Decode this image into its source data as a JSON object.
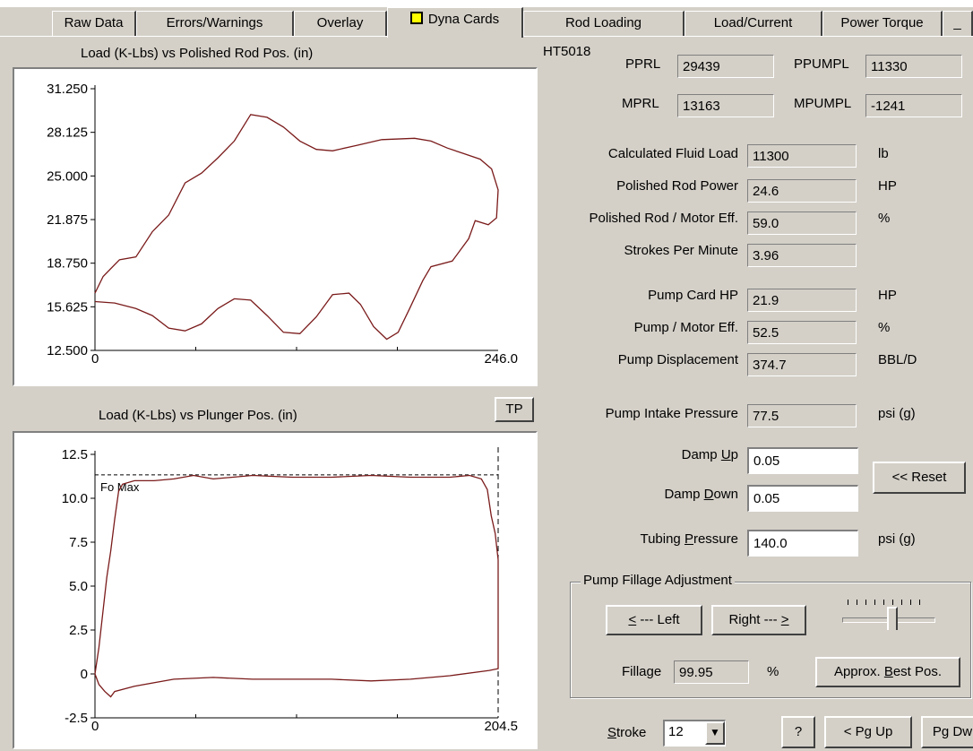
{
  "tabs": [
    {
      "label": "Raw Data"
    },
    {
      "label": "Errors/Warnings"
    },
    {
      "label": "Overlay"
    },
    {
      "label": "Dyna Cards"
    },
    {
      "label": "Rod Loading"
    },
    {
      "label": "Load/Current"
    },
    {
      "label": "Power Torque"
    }
  ],
  "well_id": "HT5018",
  "loads": {
    "pprl_label": "PPRL",
    "pprl": "29439",
    "ppumpl_label": "PPUMPL",
    "ppumpl": "11330",
    "mprl_label": "MPRL",
    "mprl": "13163",
    "mpumpl_label": "MPUMPL",
    "mpumpl": "-1241"
  },
  "metrics": [
    {
      "label": "Calculated Fluid Load",
      "value": "11300",
      "unit": "lb"
    },
    {
      "label": "Polished Rod Power",
      "value": "24.6",
      "unit": "HP"
    },
    {
      "label": "Polished Rod / Motor Eff.",
      "value": "59.0",
      "unit": "%"
    },
    {
      "label": "Strokes Per Minute",
      "value": "3.96",
      "unit": ""
    },
    {
      "label": "Pump Card HP",
      "value": "21.9",
      "unit": "HP"
    },
    {
      "label": "Pump / Motor Eff.",
      "value": "52.5",
      "unit": "%"
    },
    {
      "label": "Pump Displacement",
      "value": "374.7",
      "unit": "BBL/D"
    },
    {
      "label": "Pump Intake Pressure",
      "value": "77.5",
      "unit": "psi (g)"
    }
  ],
  "damping": {
    "up_label_pre": "Damp ",
    "up_label_key": "U",
    "up_label_post": "p",
    "up_value": "0.05",
    "down_label_pre": "Damp ",
    "down_label_key": "D",
    "down_label_post": "own",
    "down_value": "0.05",
    "reset_label": "<< Reset"
  },
  "tubing": {
    "label_pre": "Tubing ",
    "label_key": "P",
    "label_post": "ressure",
    "value": "140.0",
    "unit": "psi (g)"
  },
  "fillage": {
    "group_title": "Pump Fillage Adjustment",
    "left_key": "<",
    "left_rest": " --- Left",
    "right_rest": "Right --- ",
    "right_key": ">",
    "fillage_label": "Fillage",
    "fillage_value": "99.95",
    "fillage_unit": "%",
    "best_pre": "Approx. ",
    "best_key": "B",
    "best_post": "est Pos.",
    "slider_level": 0.55
  },
  "footer": {
    "stroke_key": "S",
    "stroke_rest": "troke",
    "stroke_value": "12",
    "help_label": "?",
    "pgup_label": "< Pg Up",
    "pgdn_label": "Pg Dw"
  },
  "tp_label": "TP",
  "chart_data": [
    {
      "type": "line",
      "title": "Load (K-Lbs) vs Polished Rod Pos. (in)",
      "xlabel": "",
      "ylabel": "",
      "xlim": [
        0,
        246.0
      ],
      "ylim": [
        12.5,
        31.25
      ],
      "x_tick_labels": [
        "0",
        "246.0"
      ],
      "y_tick_labels": [
        "31.250",
        "28.125",
        "25.000",
        "21.875",
        "18.750",
        "15.625",
        "12.500"
      ],
      "series": [
        {
          "values_xy": [
            [
              0,
              16.6
            ],
            [
              5,
              17.8
            ],
            [
              15,
              19.0
            ],
            [
              25,
              19.2
            ],
            [
              35,
              21.0
            ],
            [
              45,
              22.2
            ],
            [
              55,
              24.5
            ],
            [
              65,
              25.2
            ],
            [
              75,
              26.3
            ],
            [
              85,
              27.5
            ],
            [
              95,
              29.4
            ],
            [
              105,
              29.2
            ],
            [
              115,
              28.5
            ],
            [
              125,
              27.5
            ],
            [
              135,
              26.9
            ],
            [
              145,
              26.8
            ],
            [
              160,
              27.2
            ],
            [
              175,
              27.6
            ],
            [
              195,
              27.7
            ],
            [
              205,
              27.5
            ],
            [
              215,
              27.0
            ],
            [
              225,
              26.6
            ],
            [
              235,
              26.2
            ],
            [
              242,
              25.5
            ],
            [
              246,
              24.0
            ],
            [
              245,
              22.0
            ],
            [
              240,
              21.5
            ],
            [
              232,
              21.8
            ],
            [
              228,
              20.5
            ],
            [
              218,
              18.9
            ],
            [
              205,
              18.5
            ],
            [
              200,
              17.5
            ],
            [
              192,
              15.5
            ],
            [
              185,
              13.8
            ],
            [
              178,
              13.3
            ],
            [
              170,
              14.2
            ],
            [
              162,
              15.8
            ],
            [
              155,
              16.6
            ],
            [
              145,
              16.5
            ],
            [
              135,
              14.9
            ],
            [
              125,
              13.7
            ],
            [
              115,
              13.8
            ],
            [
              105,
              15.0
            ],
            [
              95,
              16.1
            ],
            [
              85,
              16.2
            ],
            [
              75,
              15.5
            ],
            [
              65,
              14.4
            ],
            [
              55,
              13.9
            ],
            [
              45,
              14.1
            ],
            [
              35,
              15.0
            ],
            [
              25,
              15.5
            ],
            [
              12,
              15.9
            ],
            [
              0,
              16.0
            ]
          ]
        }
      ],
      "grid": false
    },
    {
      "type": "line",
      "title": "Load (K-Lbs) vs Plunger Pos. (in)",
      "xlabel": "",
      "ylabel": "",
      "xlim": [
        0,
        204.5
      ],
      "ylim": [
        -2.5,
        12.5
      ],
      "x_tick_labels": [
        "0",
        "204.5"
      ],
      "y_tick_labels": [
        "12.5",
        "10.0",
        "7.5",
        "5.0",
        "2.5",
        "0",
        "-2.5"
      ],
      "annotations": [
        "Fo Max"
      ],
      "fo_max": 11.33,
      "series": [
        {
          "values_xy": [
            [
              0,
              0
            ],
            [
              2,
              1.5
            ],
            [
              4,
              3.5
            ],
            [
              6,
              5.5
            ],
            [
              8,
              7.0
            ],
            [
              10,
              8.8
            ],
            [
              12,
              10.4
            ],
            [
              14,
              10.8
            ],
            [
              20,
              11.0
            ],
            [
              30,
              11.0
            ],
            [
              40,
              11.1
            ],
            [
              50,
              11.3
            ],
            [
              60,
              11.1
            ],
            [
              80,
              11.3
            ],
            [
              100,
              11.2
            ],
            [
              120,
              11.2
            ],
            [
              140,
              11.3
            ],
            [
              160,
              11.2
            ],
            [
              180,
              11.2
            ],
            [
              190,
              11.3
            ],
            [
              196,
              11.1
            ],
            [
              199,
              10.5
            ],
            [
              201,
              9.0
            ],
            [
              203,
              8.0
            ],
            [
              204.5,
              6.5
            ],
            [
              204.5,
              0.3
            ],
            [
              200,
              0.2
            ],
            [
              180,
              -0.1
            ],
            [
              160,
              -0.3
            ],
            [
              140,
              -0.4
            ],
            [
              120,
              -0.3
            ],
            [
              100,
              -0.3
            ],
            [
              80,
              -0.3
            ],
            [
              60,
              -0.2
            ],
            [
              40,
              -0.3
            ],
            [
              20,
              -0.7
            ],
            [
              10,
              -1.0
            ],
            [
              8,
              -1.3
            ],
            [
              5,
              -1.0
            ],
            [
              2,
              -0.6
            ],
            [
              0,
              0
            ]
          ]
        }
      ],
      "grid": false
    }
  ]
}
